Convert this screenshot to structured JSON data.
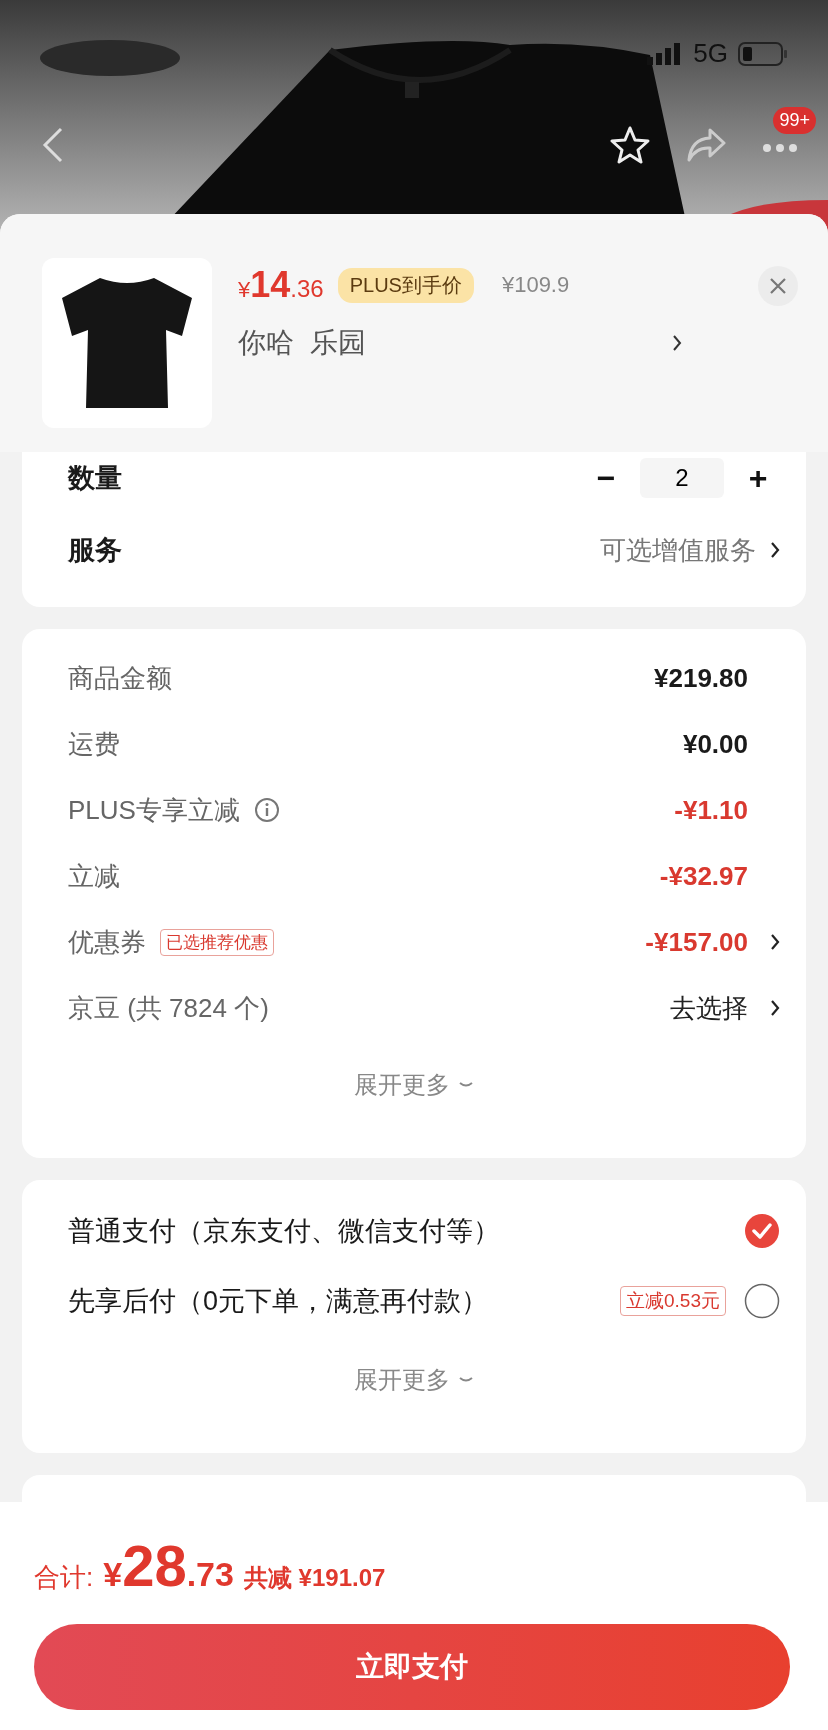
{
  "status_bar": {
    "network": "5G"
  },
  "nav": {
    "badge": "99+"
  },
  "product": {
    "price": {
      "symbol": "¥",
      "integer": "14",
      "decimal": ".36"
    },
    "price_tag": "PLUS到手价",
    "original_price": "¥109.9",
    "variant": "你哈  乐园"
  },
  "options": [
    {
      "kind": "quantity",
      "label": "数量",
      "value": "2",
      "minus": "−",
      "plus": "+"
    },
    {
      "kind": "link",
      "label": "服务",
      "value": "可选增值服务"
    }
  ],
  "fees": [
    {
      "label": "商品金额",
      "value": "¥219.80",
      "kind": "amount",
      "info": false,
      "arrow": false
    },
    {
      "label": "运费",
      "value": "¥0.00",
      "kind": "amount",
      "info": false,
      "arrow": false
    },
    {
      "label": "PLUS专享立减",
      "value": "-¥1.10",
      "kind": "discount",
      "info": true,
      "arrow": false
    },
    {
      "label": "立减",
      "value": "-¥32.97",
      "kind": "discount",
      "info": false,
      "arrow": false
    },
    {
      "label": "优惠券",
      "tag": "已选推荐优惠",
      "value": "-¥157.00",
      "kind": "discount",
      "info": false,
      "arrow": true
    },
    {
      "label": "京豆 (共 7824 个)",
      "value": "去选择",
      "kind": "action",
      "info": false,
      "arrow": true
    }
  ],
  "fees_expand": "展开更多",
  "payments": [
    {
      "label": "普通支付（京东支付、微信支付等）",
      "selected": true
    },
    {
      "label": "先享后付（0元下单，满意再付款）",
      "tag": "立减0.53元",
      "selected": false
    }
  ],
  "payments_expand": "展开更多",
  "total": {
    "label": "合计:",
    "symbol": "¥",
    "integer": "28",
    "decimal": ".73",
    "saved": "共减 ¥191.07"
  },
  "pay_button": "立即支付"
}
